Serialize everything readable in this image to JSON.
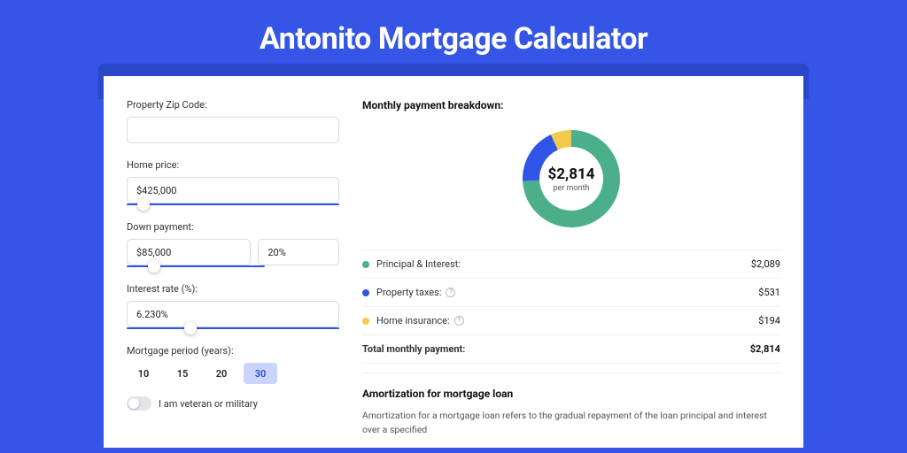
{
  "title": "Antonito Mortgage Calculator",
  "left": {
    "zip_label": "Property Zip Code:",
    "zip_value": "",
    "home_price_label": "Home price:",
    "home_price_value": "$425,000",
    "home_price_slider_pos": 8,
    "down_payment_label": "Down payment:",
    "down_payment_value": "$85,000",
    "down_payment_pct": "20%",
    "down_payment_slider_pos": 20,
    "interest_label": "Interest rate (%):",
    "interest_value": "6.230%",
    "interest_slider_pos": 30,
    "period_label": "Mortgage period (years):",
    "period_options": [
      "10",
      "15",
      "20",
      "30"
    ],
    "period_selected": "30",
    "veteran_label": "I am veteran or military"
  },
  "right": {
    "breakdown_title": "Monthly payment breakdown:",
    "center_amount": "$2,814",
    "center_sub": "per month",
    "items": [
      {
        "label": "Principal & Interest:",
        "value": "$2,089",
        "color": "#4aaf8a",
        "info": false
      },
      {
        "label": "Property taxes:",
        "value": "$531",
        "color": "#2f55e6",
        "info": true
      },
      {
        "label": "Home insurance:",
        "value": "$194",
        "color": "#f2c94c",
        "info": true
      }
    ],
    "total_label": "Total monthly payment:",
    "total_value": "$2,814",
    "amort_title": "Amortization for mortgage loan",
    "amort_text": "Amortization for a mortgage loan refers to the gradual repayment of the loan principal and interest over a specified"
  },
  "chart_data": {
    "type": "pie",
    "title": "Monthly payment breakdown",
    "series": [
      {
        "name": "Principal & Interest",
        "value": 2089,
        "color": "#4aaf8a"
      },
      {
        "name": "Property taxes",
        "value": 531,
        "color": "#2f55e6"
      },
      {
        "name": "Home insurance",
        "value": 194,
        "color": "#f2c94c"
      }
    ],
    "total": 2814,
    "center_label": "$2,814 per month"
  }
}
